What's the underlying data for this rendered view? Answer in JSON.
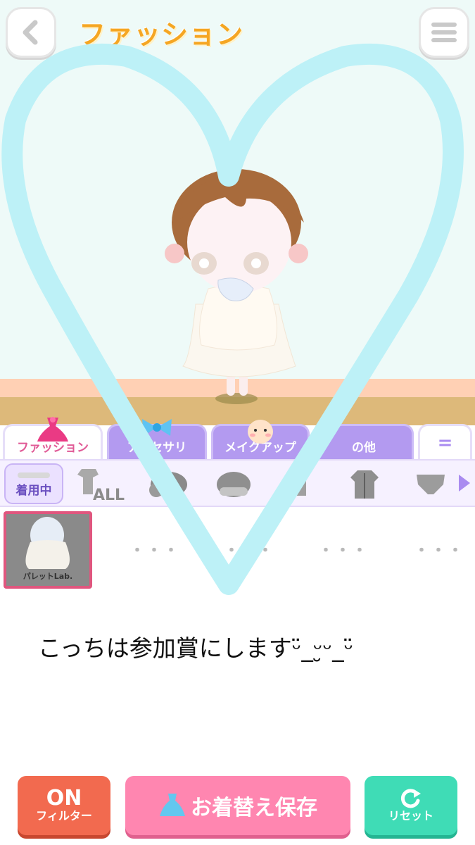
{
  "header": {
    "title": "ファッション",
    "back_icon": "chevron-left-icon",
    "menu_icon": "hamburger-menu-icon"
  },
  "category_tabs": [
    {
      "label": "ファッション",
      "icon": "dress-icon",
      "active": true
    },
    {
      "label": "アクセサリ",
      "icon": "ribbon-icon",
      "active": false
    },
    {
      "label": "メイクアップ",
      "icon": "face-icon",
      "active": false
    },
    {
      "label": "の他",
      "icon": "other-icon",
      "active": false
    },
    {
      "label": "=",
      "icon": "equals-icon",
      "active": false
    }
  ],
  "sub_categories": {
    "wearing_label": "着用中",
    "all_label": "ALL",
    "items": [
      "all-clothes-icon",
      "hair-icon",
      "head-icon",
      "top-icon",
      "jacket-icon",
      "bottom-icon"
    ]
  },
  "items": {
    "selected_brand": "パレットLab.",
    "placeholder": "・・・"
  },
  "overlay_text": "こっちは参加賞にしますᵕ̈_ᵕ̮ᵕ_ᵕ̈",
  "bottom_bar": {
    "filter_top": "ON",
    "filter_bottom": "フィルター",
    "save_label": "お着替え保存",
    "reset_label": "リセット"
  },
  "colors": {
    "heart": "#bdf1f7",
    "title": "#f5a623",
    "active_tab_text": "#e05a96",
    "tab_bg": "#b39af0",
    "filter_btn": "#f26a4f",
    "save_btn": "#ff86b0",
    "reset_btn": "#3fdcb6"
  }
}
